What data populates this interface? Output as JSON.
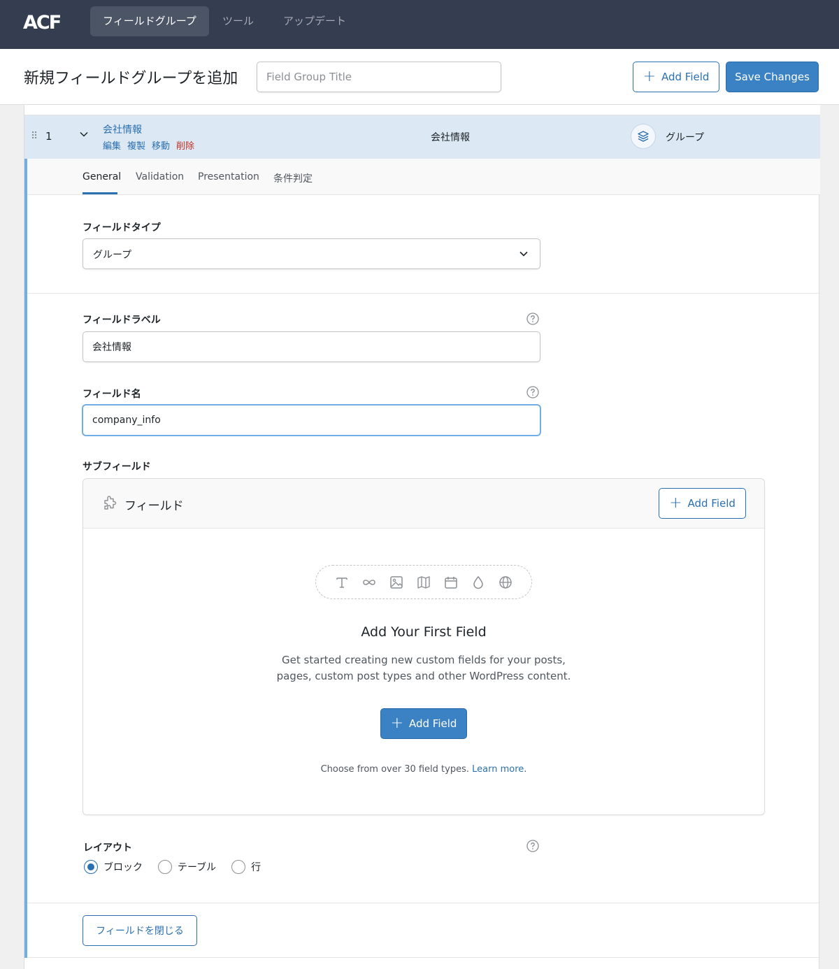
{
  "nav": {
    "logo_text": "ACF",
    "items": [
      {
        "label": "フィールドグループ",
        "active": true
      },
      {
        "label": "ツール",
        "active": false
      },
      {
        "label": "アップデート",
        "active": false
      }
    ]
  },
  "header": {
    "title": "新規フィールドグループを追加",
    "title_input_placeholder": "Field Group Title",
    "title_input_value": "",
    "add_field_label": "Add Field",
    "save_label": "Save Changes"
  },
  "field_row": {
    "number": "1",
    "label": "会社情報",
    "actions": {
      "edit": "編集",
      "duplicate": "複製",
      "move": "移動",
      "delete": "削除"
    },
    "name": "会社情報",
    "type": "グループ"
  },
  "tabs": [
    {
      "label": "General",
      "active": true
    },
    {
      "label": "Validation",
      "active": false
    },
    {
      "label": "Presentation",
      "active": false
    },
    {
      "label": "条件判定",
      "active": false
    }
  ],
  "settings": {
    "field_type_label": "フィールドタイプ",
    "field_type_value": "グループ",
    "field_label_label": "フィールドラベル",
    "field_label_value": "会社情報",
    "field_name_label": "フィールド名",
    "field_name_value": "company_info",
    "sub_fields_label": "サブフィールド",
    "layout_label": "レイアウト",
    "layout_options": [
      {
        "label": "ブロック",
        "checked": true
      },
      {
        "label": "テーブル",
        "checked": false
      },
      {
        "label": "行",
        "checked": false
      }
    ],
    "close_button_label": "フィールドを閉じる"
  },
  "sub_fields": {
    "title": "フィールド",
    "add_field_label": "Add Field",
    "empty_title": "Add Your First Field",
    "empty_desc": "Get started creating new custom fields for your posts, pages, custom post types and other WordPress content.",
    "empty_button_label": "Add Field",
    "footer_text": "Choose from over 30 field types.",
    "footer_link": "Learn more",
    "footer_period": "."
  },
  "colors": {
    "nav_bg": "#353e50",
    "accent": "#2b70b0",
    "primary_button": "#3b82c4",
    "delete": "#c22f25",
    "row_highlight": "#dce8f3"
  }
}
